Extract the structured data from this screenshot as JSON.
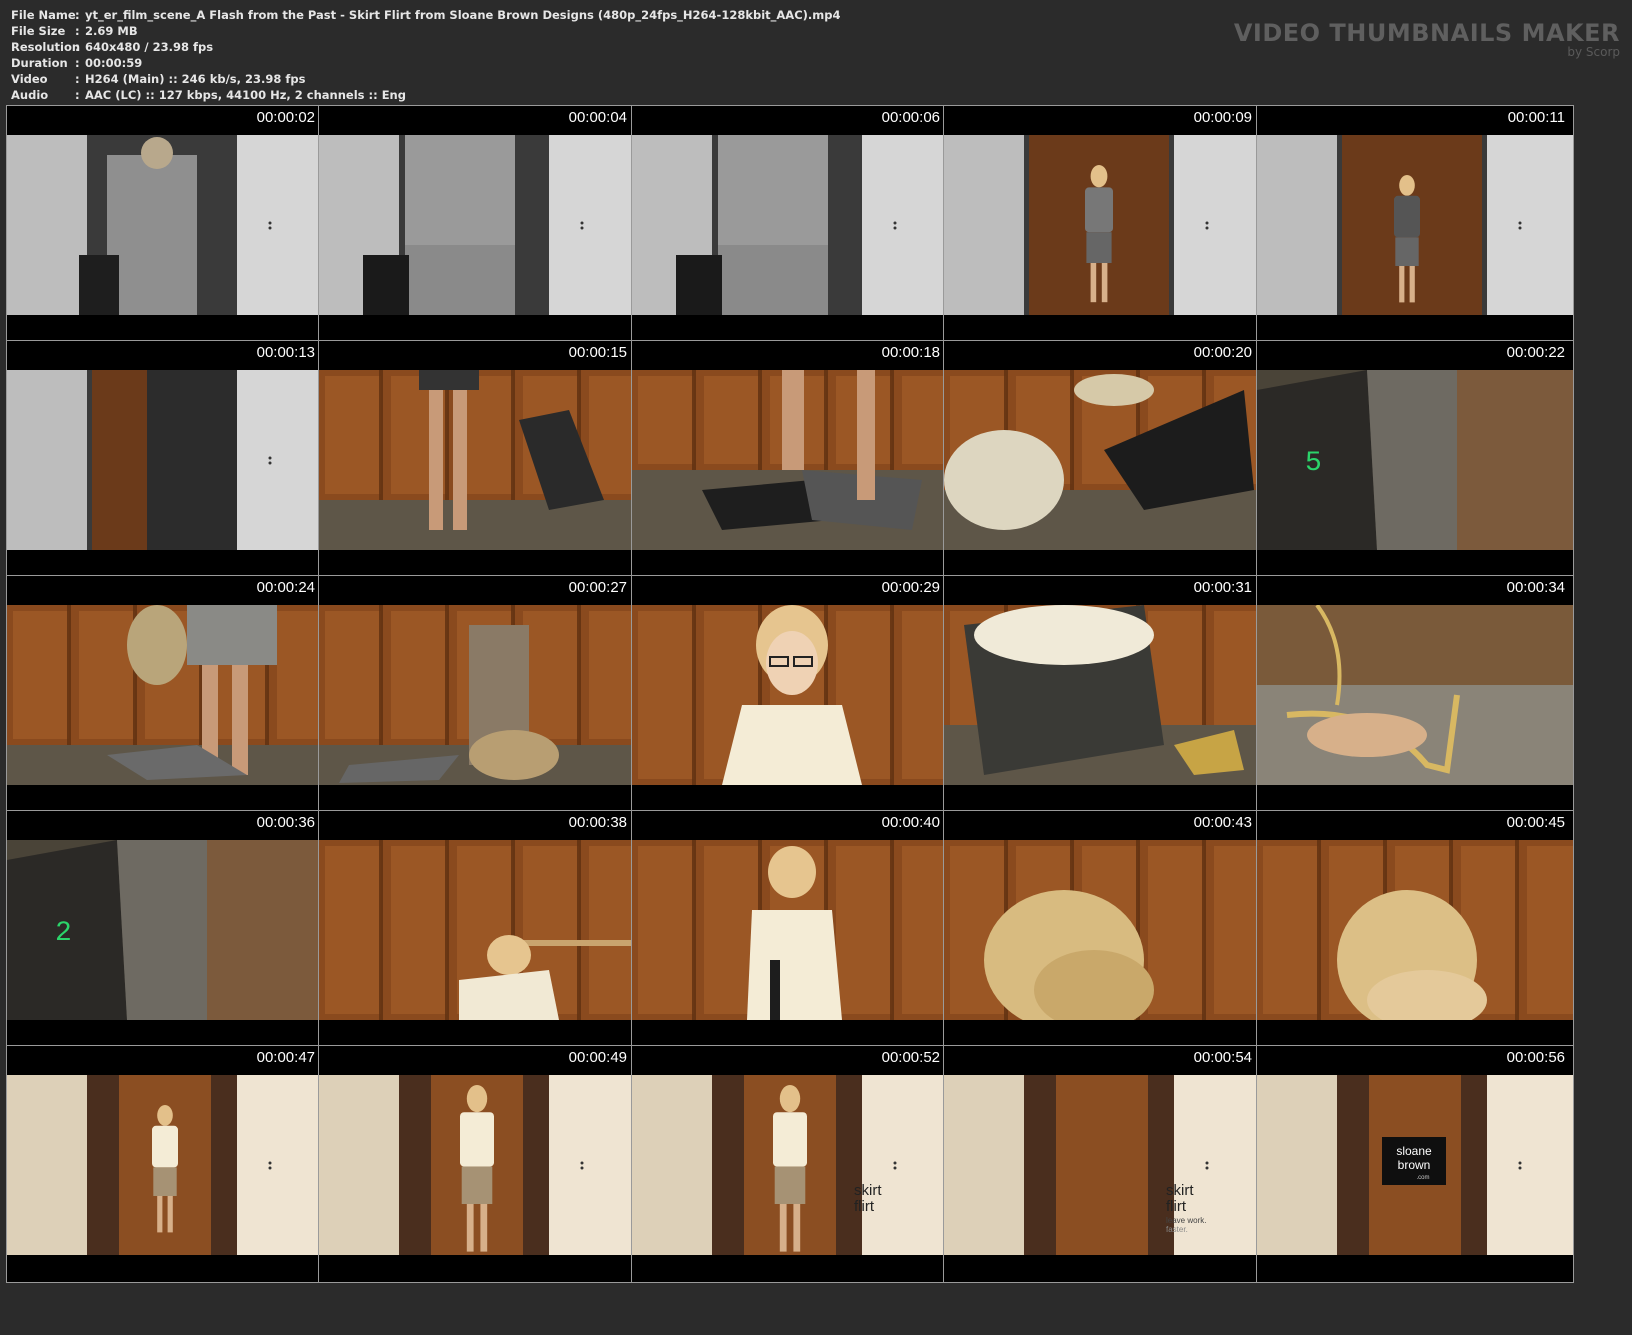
{
  "info": [
    {
      "key": "File Name",
      "value": "yt_er_film_scene_A Flash from the Past - Skirt Flirt from Sloane Brown Designs (480p_24fps_H264-128kbit_AAC).mp4"
    },
    {
      "key": "File Size",
      "value": "2.69 MB"
    },
    {
      "key": "Resolution",
      "value": "640x480 / 23.98 fps"
    },
    {
      "key": "Duration",
      "value": "00:00:59"
    },
    {
      "key": "Video",
      "value": "H264 (Main) :: 246 kb/s, 23.98 fps"
    },
    {
      "key": "Audio",
      "value": "AAC (LC) :: 127 kbps, 44100 Hz, 2 channels :: Eng"
    }
  ],
  "separator": ":",
  "brand": {
    "title": "VIDEO THUMBNAILS MAKER",
    "subtitle": "by Scorp"
  },
  "thumbnails": [
    {
      "time": "00:00:02",
      "scene": "hallway-door-back"
    },
    {
      "time": "00:00:04",
      "scene": "hallway-door-back-close"
    },
    {
      "time": "00:00:06",
      "scene": "hallway-door-back-close"
    },
    {
      "time": "00:00:09",
      "scene": "elevator-entering"
    },
    {
      "time": "00:00:11",
      "scene": "elevator-standing"
    },
    {
      "time": "00:00:13",
      "scene": "hallway-door-closing"
    },
    {
      "time": "00:00:15",
      "scene": "elevator-legs"
    },
    {
      "time": "00:00:18",
      "scene": "elevator-floor-clothes"
    },
    {
      "time": "00:00:20",
      "scene": "elevator-bending"
    },
    {
      "time": "00:00:22",
      "scene": "elevator-panel",
      "floor": "5"
    },
    {
      "time": "00:00:24",
      "scene": "elevator-legs-skirt"
    },
    {
      "time": "00:00:27",
      "scene": "elevator-changing"
    },
    {
      "time": "00:00:29",
      "scene": "elevator-portrait"
    },
    {
      "time": "00:00:31",
      "scene": "elevator-bending-low"
    },
    {
      "time": "00:00:34",
      "scene": "gold-heels"
    },
    {
      "time": "00:00:36",
      "scene": "elevator-panel",
      "floor": "2"
    },
    {
      "time": "00:00:38",
      "scene": "elevator-crouching"
    },
    {
      "time": "00:00:40",
      "scene": "elevator-standing-blouse"
    },
    {
      "time": "00:00:43",
      "scene": "hair-closeup"
    },
    {
      "time": "00:00:45",
      "scene": "hair-closeup-2"
    },
    {
      "time": "00:00:47",
      "scene": "hallway-exit-far"
    },
    {
      "time": "00:00:49",
      "scene": "hallway-exit-near"
    },
    {
      "time": "00:00:52",
      "scene": "hallway-exit-text",
      "line1": "skirt",
      "line2": "flirt"
    },
    {
      "time": "00:00:54",
      "scene": "hallway-empty-text",
      "line1": "skirt",
      "line2": "flirt",
      "line3": "leave work.",
      "line4": "faster."
    },
    {
      "time": "00:00:56",
      "scene": "hallway-logo",
      "logo1": "sloane",
      "logo2": "brown",
      "logo3": ".com"
    }
  ]
}
